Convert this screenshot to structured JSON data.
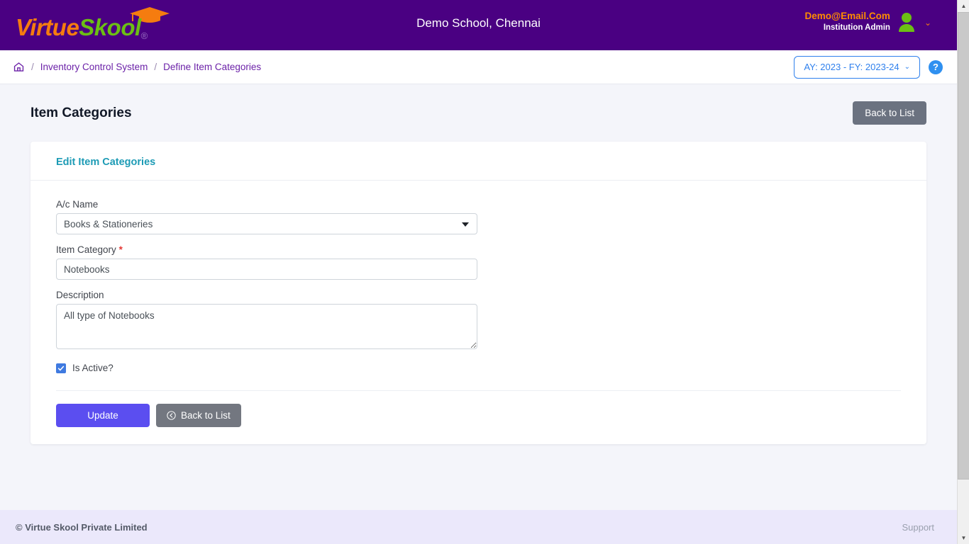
{
  "brand": {
    "name_part1": "Virtue",
    "name_part2": "Skool",
    "registered_mark": "®",
    "cap_icon": "graduation-cap-icon",
    "color_orange": "#f57c0f",
    "color_green": "#6cbf14",
    "header_bg": "#4a0082"
  },
  "header": {
    "school_title": "Demo School, Chennai",
    "user_email": "Demo@Email.Com",
    "user_role": "Institution Admin",
    "avatar_icon": "user-avatar-icon",
    "caret_icon": "chevron-down-icon"
  },
  "breadcrumb": {
    "home_icon": "home-icon",
    "separator": "/",
    "items": [
      {
        "label": "Inventory Control System"
      },
      {
        "label": "Define Item Categories"
      }
    ],
    "academic_year": {
      "label": "AY: 2023 - FY: 2023-24",
      "caret_icon": "chevron-down-icon",
      "accent": "#2f80ed"
    },
    "help": {
      "glyph": "?",
      "icon": "help-circle-icon",
      "color": "#2f90f0"
    }
  },
  "page": {
    "title": "Item Categories",
    "back_to_list_top": "Back to List"
  },
  "card": {
    "title": "Edit Item Categories",
    "title_color": "#1d9bb5",
    "fields": {
      "ac_name": {
        "label": "A/c Name",
        "value": "Books & Stationeries",
        "caret_icon": "chevron-down-icon"
      },
      "item_category": {
        "label": "Item Category",
        "required_mark": "*",
        "value": "Notebooks",
        "placeholder": ""
      },
      "description": {
        "label": "Description",
        "value": "All type of Notebooks",
        "placeholder": ""
      },
      "is_active": {
        "label": "Is Active?",
        "checked": true,
        "check_glyph": "✓",
        "color": "#3f7ae0"
      }
    },
    "actions": {
      "update": "Update",
      "back_to_list": "Back to List",
      "back_icon": "circle-left-arrow-icon"
    }
  },
  "footer": {
    "copyright": "© Virtue Skool Private Limited",
    "support": "Support"
  },
  "scrollbar": {
    "up_icon": "chevron-up-icon",
    "down_icon": "chevron-down-icon"
  }
}
